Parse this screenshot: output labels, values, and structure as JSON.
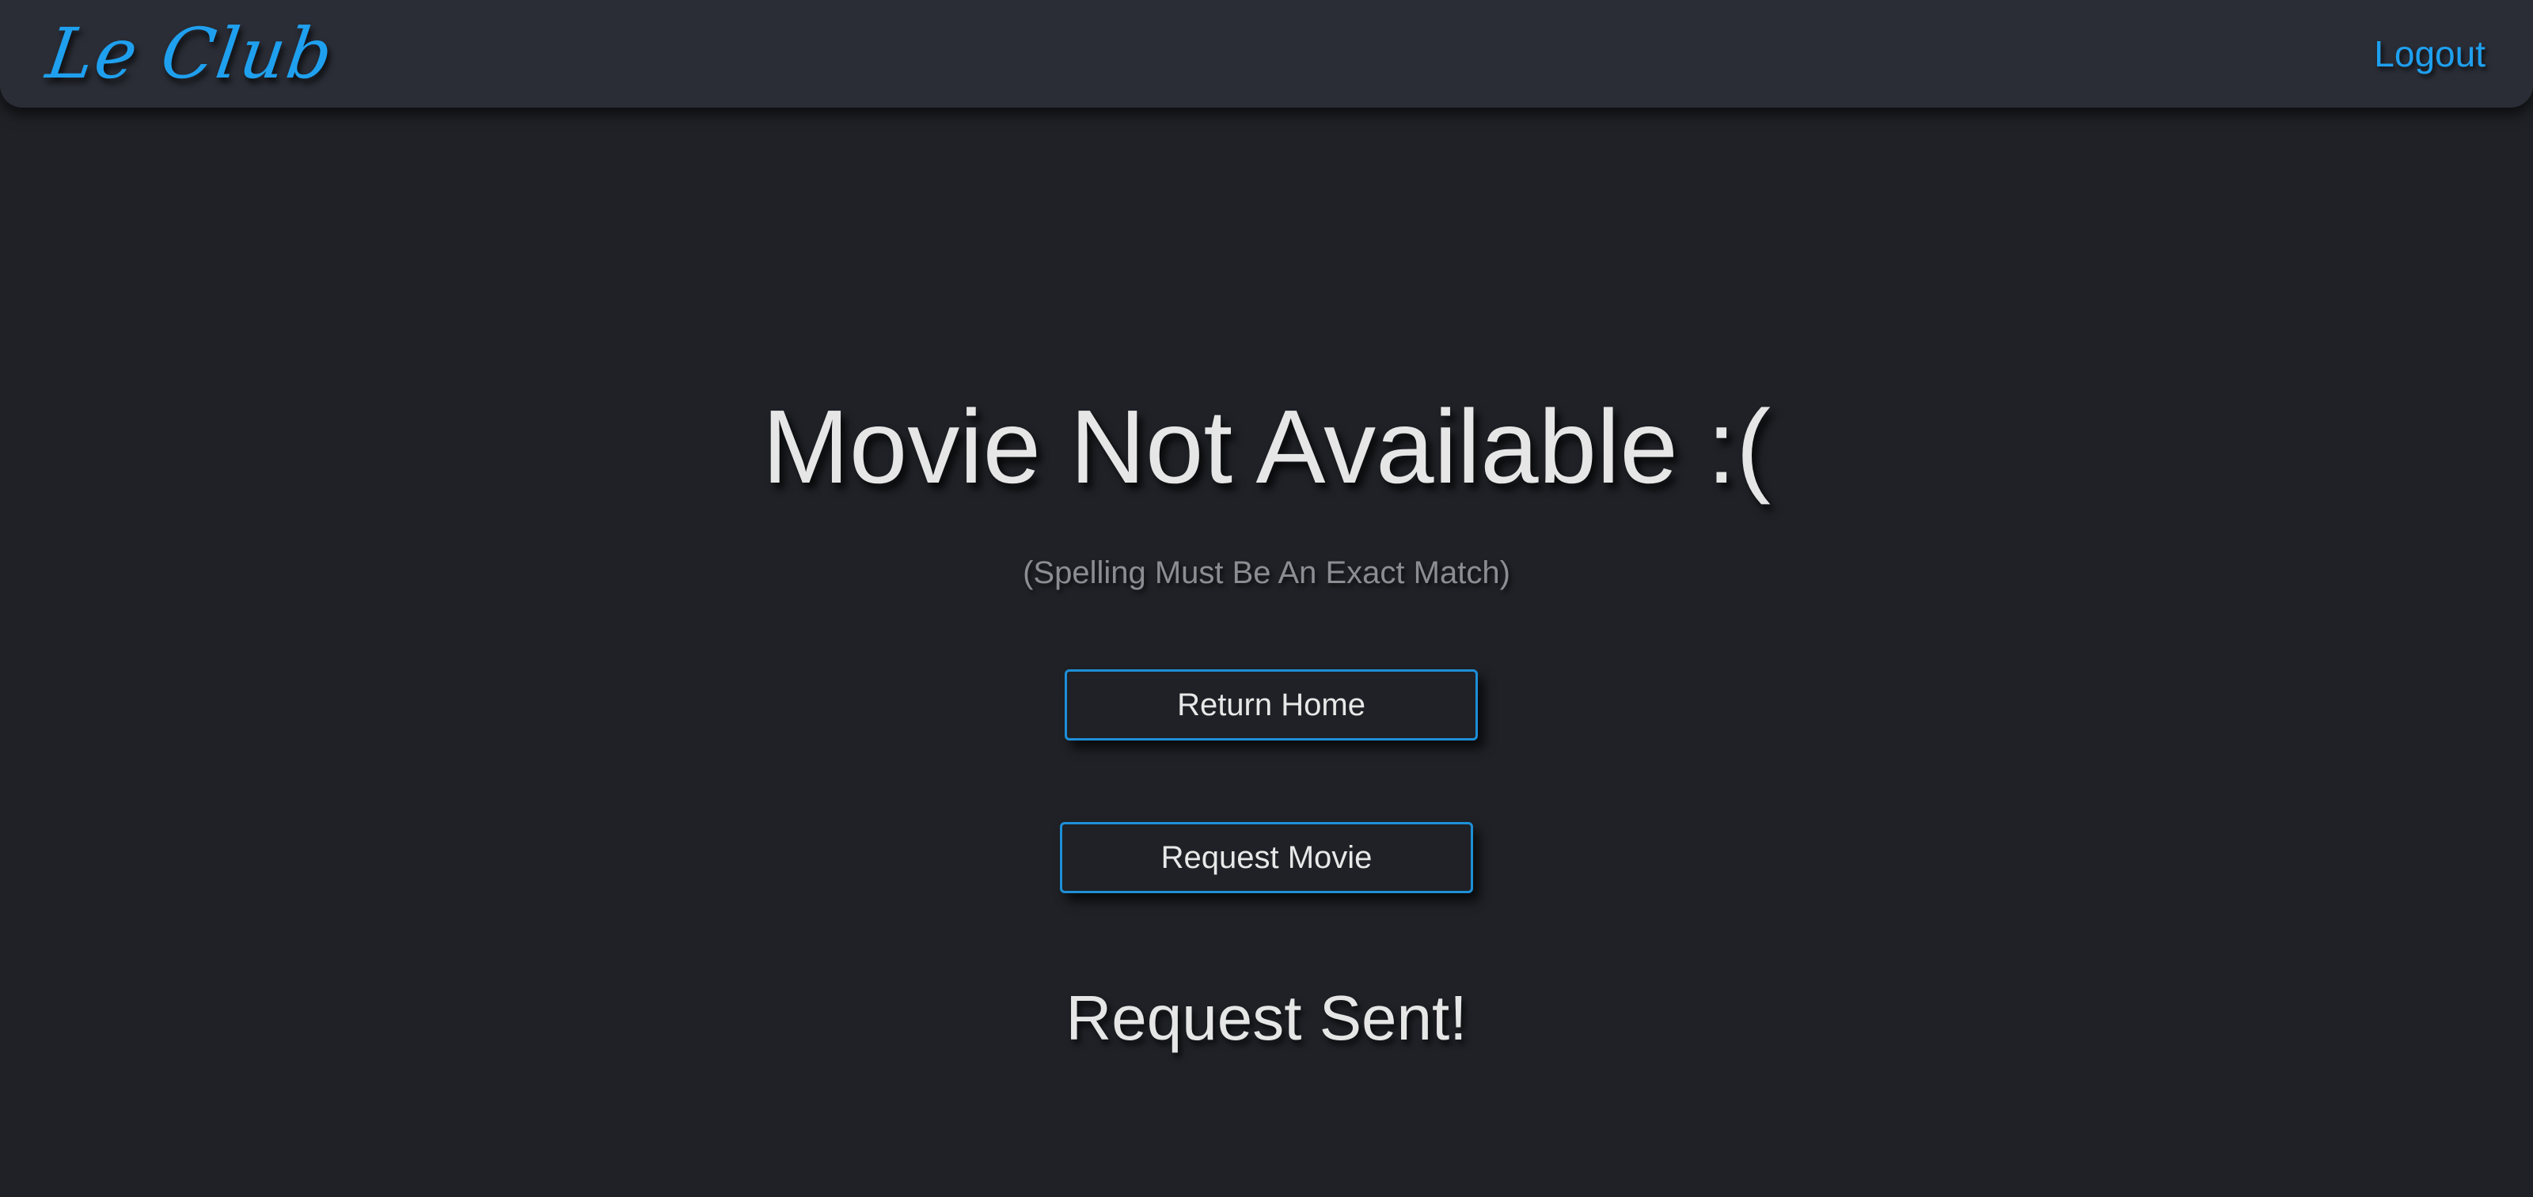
{
  "navbar": {
    "logo_text": "Le Club",
    "logout_label": "Logout"
  },
  "main": {
    "headline": "Movie Not Available :(",
    "subtitle": "(Spelling Must Be An Exact Match)",
    "return_home_label": "Return Home",
    "request_movie_label": "Request Movie",
    "status_message": "Request Sent!"
  },
  "colors": {
    "accent": "#1fa0ef",
    "background": "#1f2126",
    "navbar": "#2a2d36",
    "text": "#e6e6e6",
    "muted_text": "#8b8d92"
  }
}
